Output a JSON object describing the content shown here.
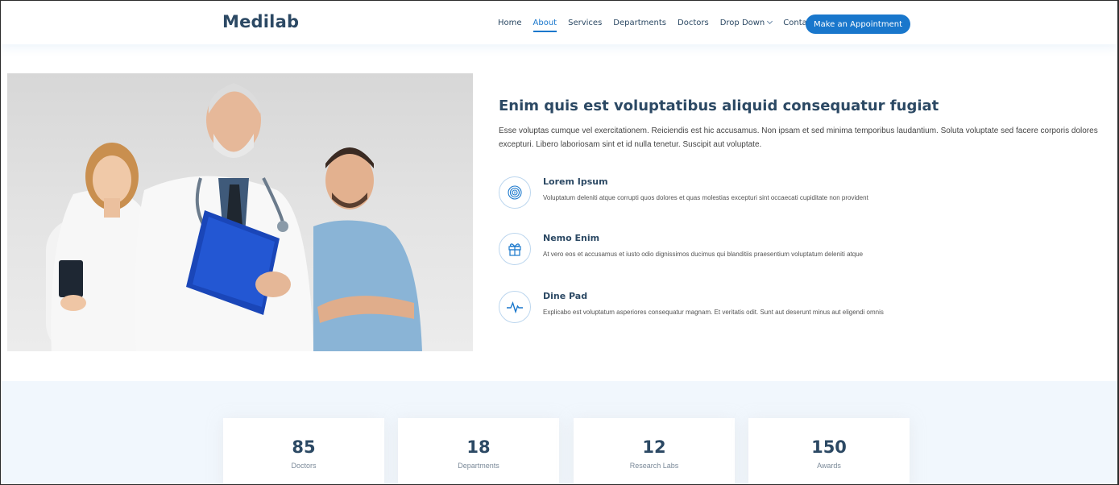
{
  "header": {
    "logo": "Medilab",
    "nav": [
      {
        "label": "Home",
        "active": false
      },
      {
        "label": "About",
        "active": true
      },
      {
        "label": "Services",
        "active": false
      },
      {
        "label": "Departments",
        "active": false
      },
      {
        "label": "Doctors",
        "active": false
      },
      {
        "label": "Drop Down",
        "active": false
      },
      {
        "label": "Contact",
        "active": false
      }
    ],
    "cta_label": "Make an Appointment"
  },
  "about": {
    "title": "Enim quis est voluptatibus aliquid consequatur fugiat",
    "text": "Esse voluptas cumque vel exercitationem. Reiciendis est hic accusamus. Non ipsam et sed minima temporibus laudantium. Soluta voluptate sed facere corporis dolores excepturi. Libero laboriosam sint et id nulla tenetur. Suscipit aut voluptate.",
    "features": [
      {
        "icon": "fingerprint-icon",
        "title": "Lorem Ipsum",
        "desc": "Voluptatum deleniti atque corrupti quos dolores et quas molestias excepturi sint occaecati cupiditate non provident"
      },
      {
        "icon": "gift-icon",
        "title": "Nemo Enim",
        "desc": "At vero eos et accusamus et iusto odio dignissimos ducimus qui blanditiis praesentium voluptatum deleniti atque"
      },
      {
        "icon": "pulse-icon",
        "title": "Dine Pad",
        "desc": "Explicabo est voluptatum asperiores consequatur magnam. Et veritatis odit. Sunt aut deserunt minus aut eligendi omnis"
      }
    ]
  },
  "counts": [
    {
      "number": "85",
      "label": "Doctors"
    },
    {
      "number": "18",
      "label": "Departments"
    },
    {
      "number": "12",
      "label": "Research Labs"
    },
    {
      "number": "150",
      "label": "Awards"
    }
  ],
  "colors": {
    "accent": "#1977cc",
    "heading": "#2c4964",
    "section_bg": "#f1f7fd"
  }
}
